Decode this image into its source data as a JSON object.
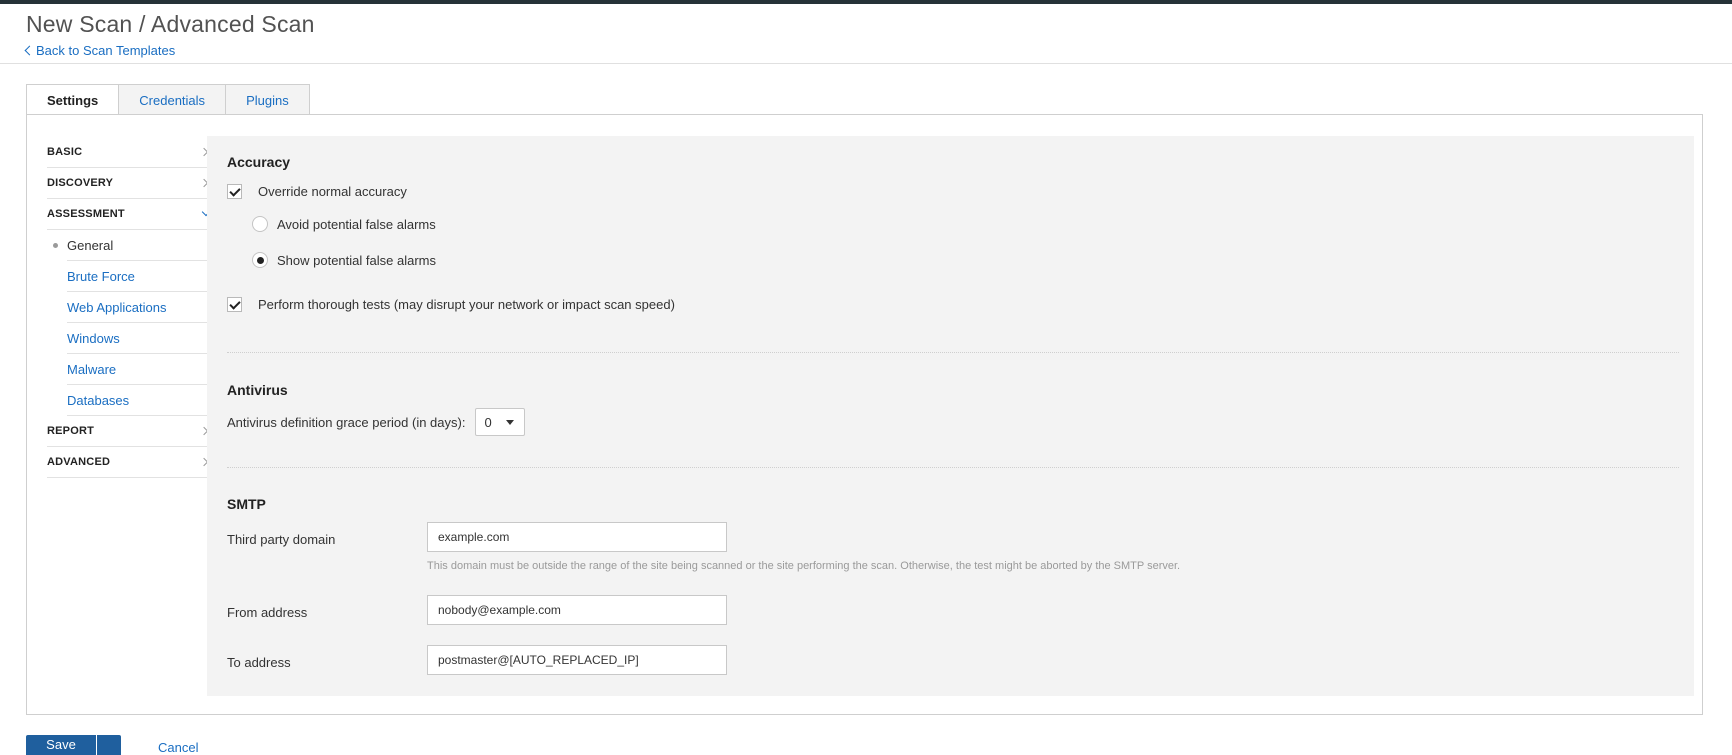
{
  "header": {
    "title": "New Scan / Advanced Scan",
    "back_link": "Back to Scan Templates"
  },
  "tabs": [
    {
      "label": "Settings",
      "active": true
    },
    {
      "label": "Credentials",
      "active": false
    },
    {
      "label": "Plugins",
      "active": false
    }
  ],
  "sidebar": {
    "items": [
      {
        "label": "BASIC",
        "state": "collapsed"
      },
      {
        "label": "DISCOVERY",
        "state": "collapsed"
      },
      {
        "label": "ASSESSMENT",
        "state": "expanded"
      },
      {
        "label": "REPORT",
        "state": "collapsed"
      },
      {
        "label": "ADVANCED",
        "state": "collapsed"
      }
    ],
    "assessment_subitems": [
      {
        "label": "General",
        "current": true
      },
      {
        "label": "Brute Force",
        "current": false
      },
      {
        "label": "Web Applications",
        "current": false
      },
      {
        "label": "Windows",
        "current": false
      },
      {
        "label": "Malware",
        "current": false
      },
      {
        "label": "Databases",
        "current": false
      }
    ]
  },
  "accuracy": {
    "title": "Accuracy",
    "override_label": "Override normal accuracy",
    "override_checked": true,
    "avoid_label": "Avoid potential false alarms",
    "avoid_selected": false,
    "show_label": "Show potential false alarms",
    "show_selected": true,
    "thorough_label": "Perform thorough tests (may disrupt your network or impact scan speed)",
    "thorough_checked": true
  },
  "antivirus": {
    "title": "Antivirus",
    "grace_label": "Antivirus definition grace period (in days):",
    "grace_value": "0"
  },
  "smtp": {
    "title": "SMTP",
    "third_party_label": "Third party domain",
    "third_party_value": "example.com",
    "third_party_help": "This domain must be outside the range of the site being scanned or the site performing the scan. Otherwise, the test might be aborted by the SMTP server.",
    "from_label": "From address",
    "from_value": "nobody@example.com",
    "to_label": "To address",
    "to_value": "postmaster@[AUTO_REPLACED_IP]"
  },
  "footer": {
    "save_label": "Save",
    "cancel_label": "Cancel"
  },
  "colors": {
    "accent": "#1a6ec2",
    "topbar": "#263238",
    "content_bg": "#f3f3f3",
    "primary_button": "#1f5f9e"
  }
}
